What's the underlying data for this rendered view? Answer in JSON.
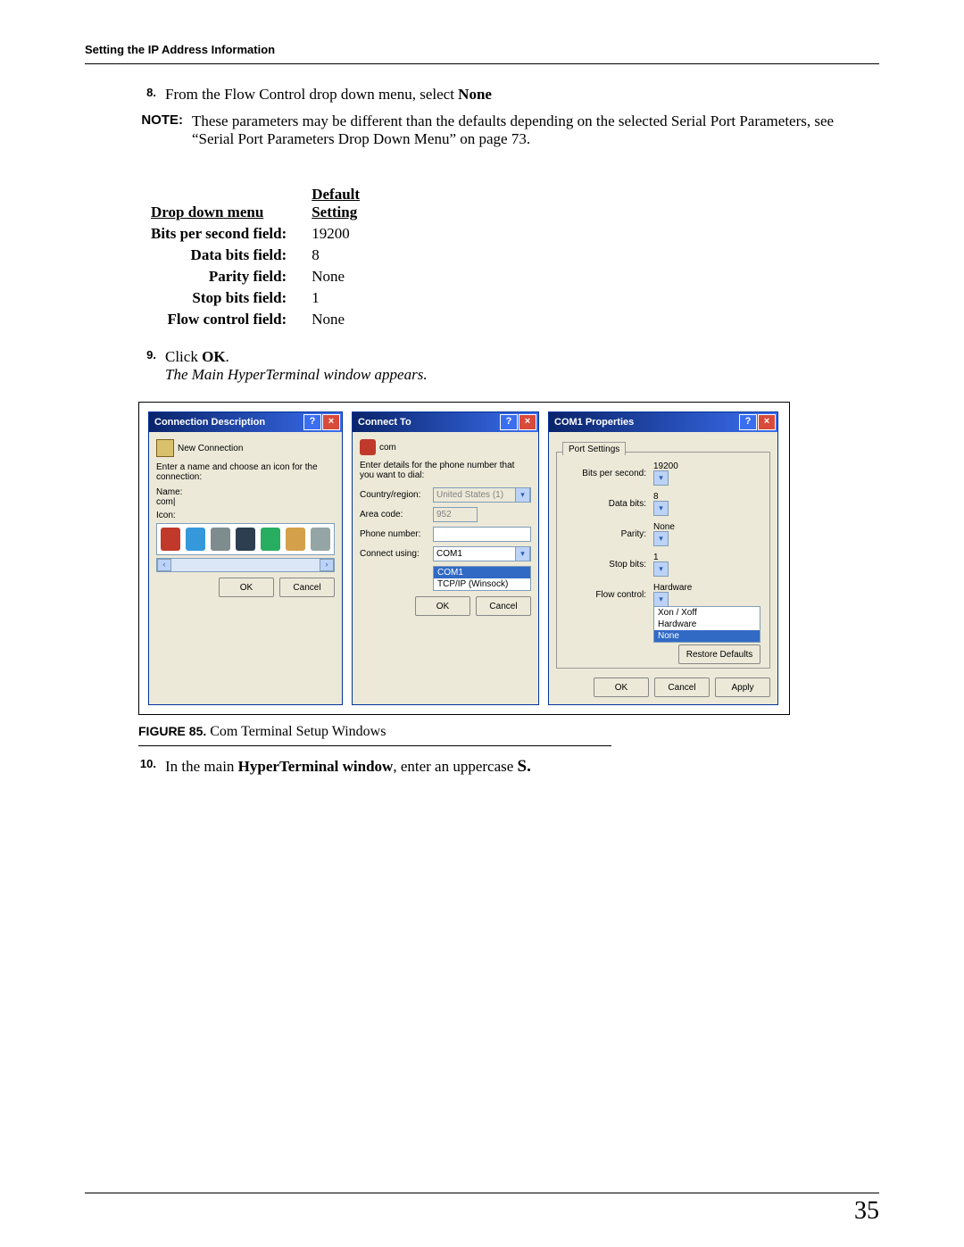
{
  "header": "Setting the IP Address Information",
  "page_number": "35",
  "steps": {
    "s8_num": "8.",
    "s8_text_a": "From the Flow Control drop down menu, select ",
    "s8_text_b": "None",
    "note_label": "NOTE:",
    "note_text": "These parameters may be different than the defaults depending on the selected Serial Port Parameters, see “Serial Port Parameters Drop Down Menu” on page 73.",
    "s9_num": "9.",
    "s9_text_a": "Click ",
    "s9_text_b": "OK",
    "s9_text_c": ".",
    "s9_italic": "The Main HyperTerminal window appears.",
    "s10_num": "10.",
    "s10_text_a": "In the main ",
    "s10_text_b": "HyperTerminal window",
    "s10_text_c": ", enter an uppercase ",
    "s10_text_d": "S."
  },
  "settings_table": {
    "col1_header": "Drop down menu",
    "col2_header_line1": "Default",
    "col2_header_line2": "Setting",
    "rows": [
      {
        "label": "Bits per second field:",
        "value": "19200"
      },
      {
        "label": "Data bits field:",
        "value": "8"
      },
      {
        "label": "Parity field:",
        "value": "None"
      },
      {
        "label": "Stop bits field:",
        "value": "1"
      },
      {
        "label": "Flow control field:",
        "value": "None"
      }
    ]
  },
  "figure": {
    "caption_label": "FIGURE 85.",
    "caption_text": " Com Terminal Setup Windows"
  },
  "dlg1": {
    "title": "Connection Description",
    "newconn": "New Connection",
    "instr": "Enter a name and choose an icon for the connection:",
    "name_label": "Name:",
    "name_value": "com|",
    "icon_label": "Icon:",
    "ok": "OK",
    "cancel": "Cancel"
  },
  "dlg2": {
    "title": "Connect To",
    "sub": "com",
    "instr": "Enter details for the phone number that you want to dial:",
    "country_label": "Country/region:",
    "country_value": "United States (1)",
    "area_label": "Area code:",
    "area_value": "952",
    "phone_label": "Phone number:",
    "phone_value": "",
    "connect_label": "Connect using:",
    "connect_value": "COM1",
    "opt_com1": "COM1",
    "opt_tcp": "TCP/IP (Winsock)",
    "ok": "OK",
    "cancel": "Cancel"
  },
  "dlg3": {
    "title": "COM1 Properties",
    "tab": "Port Settings",
    "bps_label": "Bits per second:",
    "bps_value": "19200",
    "databits_label": "Data bits:",
    "databits_value": "8",
    "parity_label": "Parity:",
    "parity_value": "None",
    "stopbits_label": "Stop bits:",
    "stopbits_value": "1",
    "flow_label": "Flow control:",
    "flow_value": "Hardware",
    "flow_opt1": "Xon / Xoff",
    "flow_opt2": "Hardware",
    "flow_opt3": "None",
    "restore": "Restore Defaults",
    "ok": "OK",
    "cancel": "Cancel",
    "apply": "Apply"
  }
}
